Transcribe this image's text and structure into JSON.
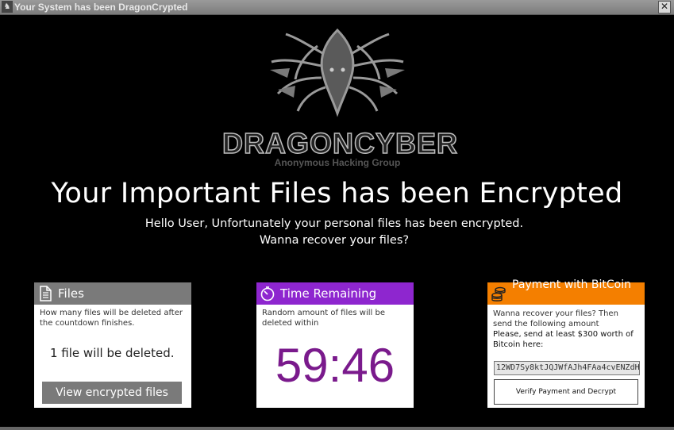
{
  "window": {
    "title": "Your System has been DragonCrypted",
    "app_icon": "dragon-icon",
    "close_glyph": "✕"
  },
  "logo": {
    "brand": "DRAGONCYBER",
    "tagline": "Anonymous Hacking Group"
  },
  "headline": "Your Important Files has been Encrypted",
  "subtext": {
    "line1": "Hello User, Unfortunately your personal files has been encrypted.",
    "line2": "Wanna recover your files?"
  },
  "panels": {
    "files": {
      "title": "Files",
      "description": "How many files will be deleted after the countdown finishes.",
      "count_text": "1 file will be deleted.",
      "button_label": "View encrypted files",
      "icon": "document-icon",
      "color": "#7a7a7a"
    },
    "timer": {
      "title": "Time Remaining",
      "description": "Random amount of files will be deleted within",
      "time": "59:46",
      "icon": "stopwatch-icon",
      "color": "#8e26cf",
      "clock_color": "#7a1a8c"
    },
    "payment": {
      "title": "Payment with BitCoin",
      "description_1": "Wanna recover your files? Then send the following amount",
      "description_2": "Please, send at least $300 worth of Bitcoin here:",
      "address": "12WD7Sy8ktJQJWfAJh4FAa4cvENZdH",
      "button_label": "Verify Payment and Decrypt",
      "icon": "coins-icon",
      "color": "#f47f00"
    }
  }
}
